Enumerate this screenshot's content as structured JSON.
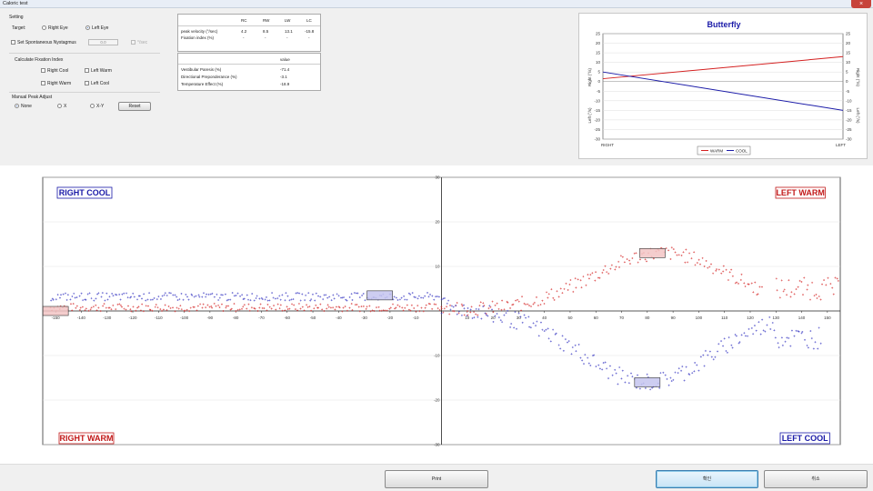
{
  "window": {
    "title": "Caloric test",
    "close_glyph": "×"
  },
  "setting": {
    "heading": "Setting",
    "target_label": "Target:",
    "right_eye": "Right Eye",
    "left_eye": "Left Eye",
    "selected": "left",
    "spontaneous_label": "Set Spontaneous Nystagmus",
    "spontaneous_value": "0.0",
    "spontaneous_unit": "°/sec"
  },
  "fixation": {
    "heading": "Calculate Fixation Index",
    "right_cool": "Right Cool",
    "left_warm": "Left Warm",
    "right_warm": "Right Warm",
    "left_cool": "Left Cool"
  },
  "peak": {
    "heading": "Manual Peak Adjust",
    "none": "None",
    "x": "X",
    "xy": "X-Y",
    "reset": "Reset"
  },
  "results": {
    "columns": [
      "RC",
      "RW",
      "LW",
      "LC"
    ],
    "rows": [
      {
        "label": "peak velocity (°/sec)",
        "values": [
          "4.2",
          "8.5",
          "13.1",
          "-15.8"
        ]
      },
      {
        "label": "Fixation index (%)",
        "values": [
          "-",
          "-",
          "-",
          "-"
        ]
      }
    ]
  },
  "summary": {
    "value_header": "value",
    "rows": [
      {
        "label": "Vestibular Paresis (%)",
        "value": "-71.4"
      },
      {
        "label": "Directional Preponderance (%)",
        "value": "-3.1"
      },
      {
        "label": "Temperature Effect (%)",
        "value": "-18.9"
      }
    ]
  },
  "butterfly": {
    "title": "Butterfly",
    "left_axis_top": "Right (°/s)",
    "left_axis_bottom": "Left (°/s)",
    "right_axis_top": "Right (°/s)",
    "right_axis_bottom": "Left (°/s)",
    "x_left": "RIGHT",
    "x_right": "LEFT",
    "y_ticks": [
      25,
      20,
      15,
      10,
      5,
      0,
      -5,
      -10,
      -15,
      -20,
      -25,
      -30
    ],
    "legend": [
      "WARM",
      "COOL"
    ],
    "warm": {
      "right": 1.5,
      "left": 13,
      "color": "#d42020"
    },
    "cool": {
      "right": 5,
      "left": -15,
      "color": "#1c1ca8"
    }
  },
  "chart_data": {
    "type": "scatter",
    "quadrant_labels": {
      "top_left": "RIGHT COOL",
      "top_right": "LEFT WARM",
      "bottom_left": "RIGHT WARM",
      "bottom_right": "LEFT COOL"
    },
    "x_ticks": [
      -150,
      -140,
      -130,
      -120,
      -110,
      -100,
      -90,
      -80,
      -70,
      -60,
      -50,
      -40,
      -30,
      -20,
      -10,
      0,
      10,
      20,
      30,
      40,
      50,
      60,
      70,
      80,
      90,
      100,
      110,
      120,
      130,
      140,
      150
    ],
    "y_ticks": [
      30,
      20,
      10,
      -10,
      -20,
      -30
    ],
    "xlim": [
      -155,
      155
    ],
    "ylim": [
      -30,
      30
    ],
    "series": [
      {
        "color": "#d42020",
        "curves": [
          {
            "x0": -152,
            "x1": 0,
            "shape": "flat",
            "mid": 0.8,
            "amp": 0,
            "jitter": 0.9
          },
          {
            "x0": 0,
            "x1": 125,
            "shape": "bump",
            "mid": 13,
            "center": 86,
            "width": 38,
            "base": 1,
            "jitter": 1.6
          },
          {
            "x0": 130,
            "x1": 155,
            "shape": "flat",
            "mid": 5,
            "amp": 0,
            "jitter": 2.5
          }
        ]
      },
      {
        "color": "#3030c0",
        "curves": [
          {
            "x0": -152,
            "x1": 0,
            "shape": "flat",
            "mid": 3.2,
            "amp": 0,
            "jitter": 0.9
          },
          {
            "x0": 0,
            "x1": 130,
            "shape": "bump",
            "mid": -16,
            "center": 80,
            "width": 36,
            "base": 1,
            "jitter": 2.0
          },
          {
            "x0": 130,
            "x1": 148,
            "shape": "flat",
            "mid": -6,
            "amp": 0,
            "jitter": 2.5
          }
        ]
      }
    ],
    "peak_boxes": [
      {
        "x": -150,
        "y": 0,
        "color": "#d42020"
      },
      {
        "x": -24,
        "y": 3.5,
        "color": "#3030c0"
      },
      {
        "x": 82,
        "y": 13,
        "color": "#d42020"
      },
      {
        "x": 80,
        "y": -16,
        "color": "#3030c0"
      }
    ]
  },
  "buttons": {
    "print": "Print",
    "ok": "확인",
    "cancel": "취소"
  }
}
